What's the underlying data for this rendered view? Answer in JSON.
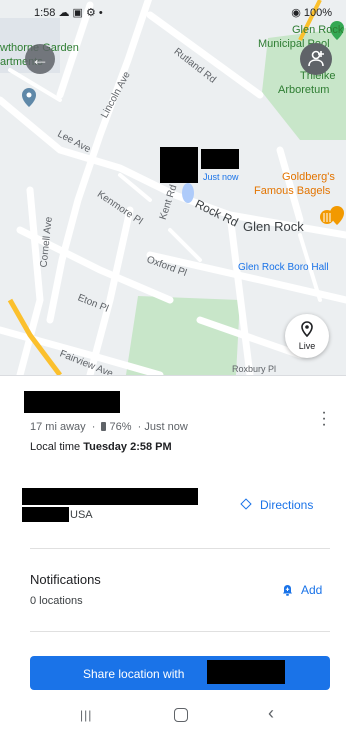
{
  "status_bar": {
    "time": "1:58",
    "left_icons": "☁ ▣ ⚙ •",
    "battery": "100%"
  },
  "map": {
    "labels": {
      "garden": "wthorne Garden",
      "apartments": "artments",
      "rutland": "Rutland Rd",
      "lincoln": "Lincoln Ave",
      "lee": "Lee Ave",
      "kenmore": "Kenmore Pl",
      "kent": "Kent Rd",
      "rock": "Rock Rd",
      "cornell": "Cornell Ave",
      "oxford": "Oxford Pl",
      "eton": "Eton Pl",
      "fairview": "Fairview Ave",
      "roxbury": "Roxbury Pl",
      "glen_rock": "Glen Rock",
      "glen_rock_poi": "Glen Rock",
      "municipal_pool": "Municipal Pool",
      "thielke": "Thielke",
      "arboretum": "Arboretum",
      "goldbergs_1": "Goldberg's",
      "goldbergs_2": "Famous Bagels",
      "boro_hall": "Glen Rock Boro Hall",
      "just_now": "Just now"
    },
    "live_label": "Live",
    "icons": {
      "back": "arrow-left-icon",
      "add_person": "person-add-icon",
      "live": "live-location-icon",
      "restaurant": "fork-knife-icon"
    }
  },
  "sheet": {
    "distance": "17 mi away",
    "battery": "76%",
    "updated": "Just now",
    "local_time_label": "Local time",
    "local_time_value": "Tuesday 2:58 PM",
    "country": "USA",
    "directions_label": "Directions",
    "notifications_title": "Notifications",
    "notifications_sub": "0 locations",
    "add_label": "Add",
    "share_label": "Share location with"
  },
  "colors": {
    "accent": "#1a73e8",
    "park": "#c8e6c9",
    "road": "#ffffff",
    "highway": "#fbc02d"
  }
}
